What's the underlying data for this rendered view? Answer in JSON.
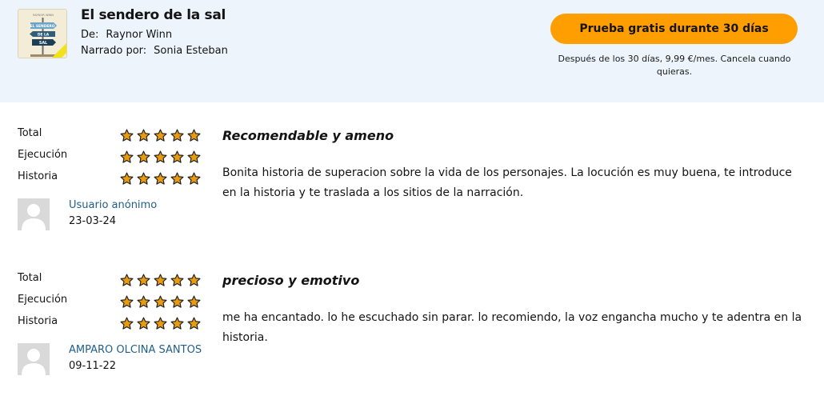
{
  "header": {
    "title": "El sendero de la sal",
    "author_label": "De:",
    "author": "Raynor Winn",
    "narrator_label": "Narrado por:",
    "narrator": "Sonia Esteban",
    "cover_text": [
      "RAYNOR WINN",
      "EL SENDERO",
      "DE LA",
      "SAL"
    ],
    "cta_label": "Prueba gratis durante 30 días",
    "cta_note": "Después de los 30 días, 9,99 €/mes. Cancela cuando quieras."
  },
  "colors": {
    "accent": "#ff9e00",
    "header_bg": "#eef4fc",
    "star": "#e89a10",
    "link": "#1f5f8b"
  },
  "reviews": [
    {
      "ratings": [
        {
          "label": "Total",
          "stars": 5
        },
        {
          "label": "Ejecución",
          "stars": 5
        },
        {
          "label": "Historia",
          "stars": 5
        }
      ],
      "user": "Usuario anónimo",
      "date": "23-03-24",
      "title": "Recomendable y ameno",
      "body": "Bonita historia de superacion sobre la vida de los personajes. La locución es muy buena, te introduce en la historia y te traslada a los sitios de la narración."
    },
    {
      "ratings": [
        {
          "label": "Total",
          "stars": 5
        },
        {
          "label": "Ejecución",
          "stars": 5
        },
        {
          "label": "Historia",
          "stars": 5
        }
      ],
      "user": "AMPARO OLCINA SANTOS",
      "date": "09-11-22",
      "title": "precioso y emotivo",
      "body": "me ha encantado. lo he escuchado sin parar. lo recomiendo, la voz engancha mucho y te adentra en la historia."
    }
  ]
}
